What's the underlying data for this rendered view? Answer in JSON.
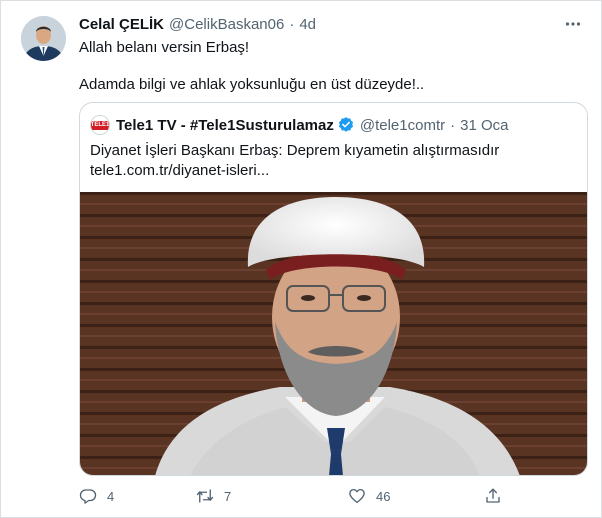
{
  "author": {
    "display_name": "Celal ÇELİK",
    "handle": "@CelikBaskan06",
    "separator": "·",
    "time": "4d",
    "avatar_icon": "user-avatar"
  },
  "tweet": {
    "line1": "Allah belanı versin Erbaş!",
    "line2": "Adamda bilgi ve ahlak yoksunluğu en üst düzeyde!.."
  },
  "quote": {
    "logo_text": "TELE1",
    "display_name": "Tele1 TV - #Tele1Susturulamaz",
    "verified_icon": "verified-badge-icon",
    "handle": "@tele1comtr",
    "separator": "·",
    "time": "31 Oca",
    "text_line1": "Diyanet İşleri Başkanı Erbaş: Deprem kıyametin alıştırmasıdır",
    "text_line2": "tele1.com.tr/diyanet-isleri..."
  },
  "actions": {
    "reply_count": "4",
    "retweet_count": "7",
    "like_count": "46"
  },
  "colors": {
    "accent": "#1d9bf0",
    "secondary_text": "#536471",
    "primary_text": "#0f1419"
  }
}
